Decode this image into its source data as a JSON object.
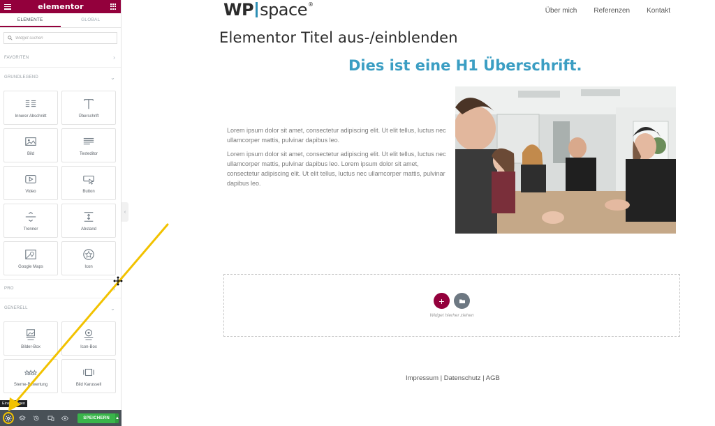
{
  "sidebar": {
    "brand": "elementor",
    "tabs": [
      "ELEMENTE",
      "GLOBAL"
    ],
    "search_placeholder": "Widget suchen",
    "categories": {
      "favoriten": "FAVORITEN",
      "grundlegend": "GRUNDLEGEND",
      "pro": "PRO",
      "generell": "GENERELL"
    },
    "grundlegend_widgets": [
      {
        "label": "Innerer Abschnitt",
        "icon": "inner-section-icon"
      },
      {
        "label": "Überschrift",
        "icon": "heading-icon"
      },
      {
        "label": "Bild",
        "icon": "image-icon"
      },
      {
        "label": "Texteditor",
        "icon": "text-editor-icon"
      },
      {
        "label": "Video",
        "icon": "video-icon"
      },
      {
        "label": "Button",
        "icon": "button-icon"
      },
      {
        "label": "Trenner",
        "icon": "divider-icon"
      },
      {
        "label": "Abstand",
        "icon": "spacer-icon"
      },
      {
        "label": "Google Maps",
        "icon": "map-icon"
      },
      {
        "label": "Icon",
        "icon": "star-icon"
      }
    ],
    "generell_widgets": [
      {
        "label": "Bilder-Box",
        "icon": "image-box-icon"
      },
      {
        "label": "Icon-Box",
        "icon": "icon-box-icon"
      },
      {
        "label": "Sterne-Bewertung",
        "icon": "star-rating-icon"
      },
      {
        "label": "Bild Karussell",
        "icon": "carousel-icon"
      }
    ],
    "tooltip": "Einstellungen",
    "save_label": "SPEICHERN"
  },
  "preview": {
    "logo_left": "WP",
    "logo_right": "space",
    "logo_reg": "®",
    "nav": [
      "Über mich",
      "Referenzen",
      "Kontakt"
    ],
    "page_title": "Elementor Titel aus-/einblenden",
    "h1": "Dies ist eine H1 Überschrift.",
    "paragraphs": [
      "Lorem ipsum dolor sit amet, consectetur adipiscing elit. Ut elit tellus, luctus nec ullamcorper mattis, pulvinar dapibus leo.",
      "Lorem ipsum dolor sit amet, consectetur adipiscing elit. Ut elit tellus, luctus nec ullamcorper mattis, pulvinar dapibus leo. Lorem ipsum dolor sit amet, consectetur adipiscing elit. Ut elit tellus, luctus nec ullamcorper mattis, pulvinar dapibus leo."
    ],
    "dropzone_text": "Widget hierher ziehen",
    "footer": "Impressum | Datenschutz | AGB"
  },
  "colors": {
    "brand": "#93003c",
    "accent_blue": "#3b9ec3",
    "save_green": "#39b54a",
    "footer_bar": "#495157",
    "arrow": "#f2c200"
  }
}
